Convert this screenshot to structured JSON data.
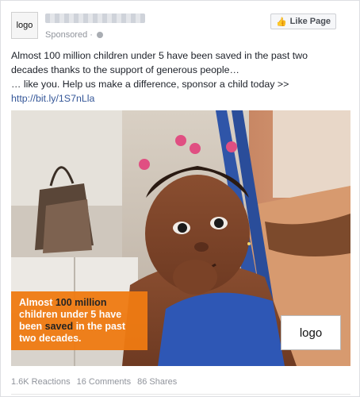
{
  "post": {
    "avatar_text": "logo",
    "sponsored_label": "Sponsored ·",
    "like_button_label": "Like Page",
    "text_line1": "Almost 100 million children under 5 have been saved in the past two decades thanks to the support of generous people…",
    "text_line2": "… like you. Help us make a difference, sponsor a child today >>",
    "link": "http://bit.ly/1S7nLla"
  },
  "image": {
    "banner": {
      "part1": "Almost ",
      "highlight1": "100 million",
      "part2": " children under 5 have been ",
      "highlight2": "saved",
      "part3": " in the past two decades."
    },
    "logo_text": "logo"
  },
  "stats": {
    "reactions": "1.6K Reactions",
    "comments": "16 Comments",
    "shares": "86 Shares"
  },
  "colors": {
    "link": "#365899",
    "banner": "#f07b12",
    "highlight": "#1a1a1a"
  }
}
